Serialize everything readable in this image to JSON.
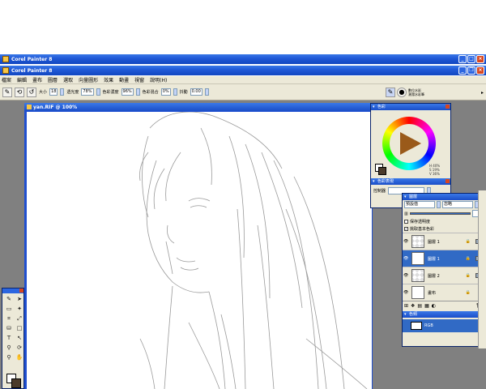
{
  "windows": {
    "back_title": "Corel Painter 8",
    "front_title": "Corel Painter 8"
  },
  "menu": [
    "檔案",
    "編輯",
    "畫布",
    "圖層",
    "選取",
    "向量圖形",
    "效果",
    "動畫",
    "視窗",
    "說明(H)"
  ],
  "propbar": {
    "size_label": "大小",
    "size_value": "18",
    "opacity_label": "透光度",
    "opacity_value": "78%",
    "resat_label": "色彩濃度",
    "resat_value": "96%",
    "bleed_label": "色彩混合",
    "bleed_value": "0%",
    "jitter_label": "抖動",
    "jitter_value": "0.00"
  },
  "brush_selector": {
    "category": "數位水彩",
    "variant": "潮濕水彩筆"
  },
  "document": {
    "title": "yan.RIF @ 100%"
  },
  "colors_panel": {
    "title": "色彩",
    "hsv": [
      "H 40%",
      "S 19%",
      "V 36%"
    ],
    "variability_title": "色彩表現",
    "control_label": "控制器"
  },
  "layers_panel": {
    "title": "圖層",
    "composite_method": "預設值",
    "composite_depth": "忽略",
    "preserve_transparency": "保存透明度",
    "pick_up_color": "挑取基本色彩",
    "layers": [
      {
        "name": "圖層 1",
        "selected": false
      },
      {
        "name": "圖層 1",
        "selected": true
      },
      {
        "name": "圖層 2",
        "selected": false
      },
      {
        "name": "畫布",
        "selected": false
      }
    ]
  },
  "channels_panel": {
    "title": "色頻",
    "channel": "RGB"
  },
  "colors": {
    "title_bar": "#1f58d6",
    "workspace": "#808080",
    "panel_bg": "#ece9d8",
    "selection": "#316ac5",
    "secondary_color": "#4a3a2a"
  }
}
